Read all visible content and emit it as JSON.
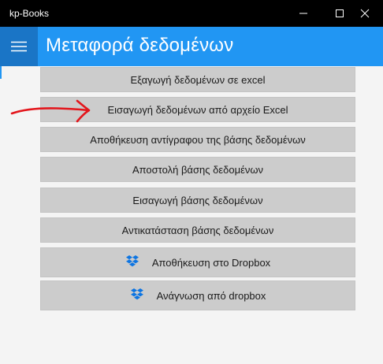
{
  "window": {
    "title": "kp-Books"
  },
  "header": {
    "menu_icon": "hamburger-icon",
    "title": "Μεταφορά δεδομένων",
    "color": "#2196f3",
    "menu_color": "#1a75c6"
  },
  "actions": [
    {
      "label": "Εξαγωγή δεδομένων σε excel",
      "icon": null
    },
    {
      "label": "Εισαγωγή δεδομένων από αρχείο Excel",
      "icon": null
    },
    {
      "label": "Αποθήκευση αντίγραφου της βάσης δεδομένων",
      "icon": null
    },
    {
      "label": "Αποστολή βάσης δεδομένων",
      "icon": null
    },
    {
      "label": "Εισαγωγή βάσης δεδομένων",
      "icon": null
    },
    {
      "label": "Αντικατάσταση βάσης δεδομένων",
      "icon": null
    },
    {
      "label": "Αποθήκευση στο Dropbox",
      "icon": "dropbox-icon"
    },
    {
      "label": "Ανάγνωση από dropbox",
      "icon": "dropbox-icon"
    }
  ],
  "annotation": {
    "icon": "red-arrow-annotation",
    "color": "#e3161c"
  }
}
